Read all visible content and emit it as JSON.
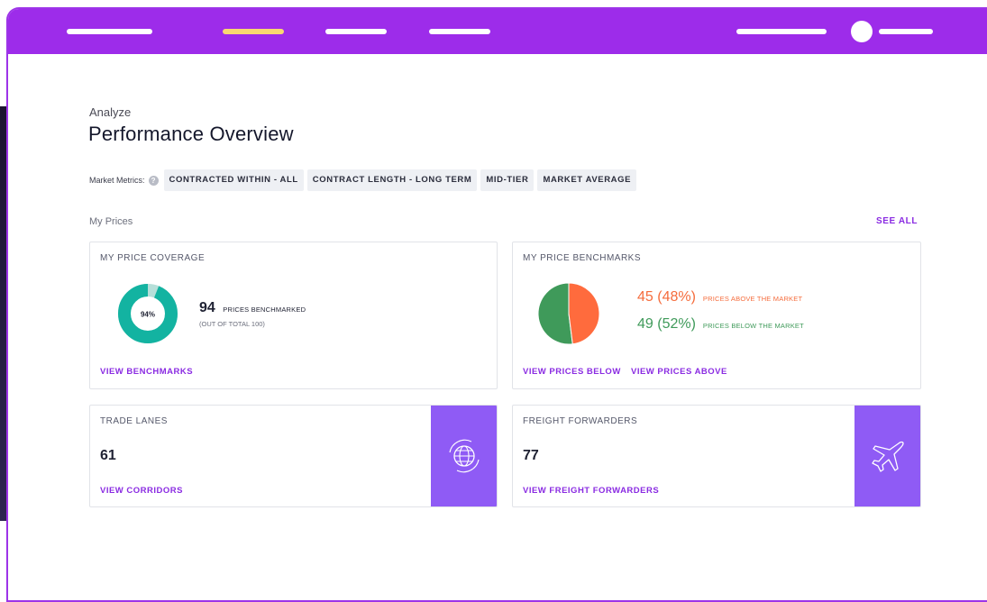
{
  "page": {
    "eyebrow": "Analyze",
    "title": "Performance Overview"
  },
  "metrics": {
    "label": "Market Metrics:",
    "help_icon": "help-circle-icon",
    "chips": [
      "CONTRACTED WITHIN - ALL",
      "CONTRACT LENGTH - LONG TERM",
      "MID-TIER",
      "MARKET AVERAGE"
    ]
  },
  "section": {
    "label": "My Prices",
    "see_all": "SEE ALL"
  },
  "coverage": {
    "title": "MY PRICE COVERAGE",
    "donut_label": "94%",
    "donut_fraction": 0.94,
    "count": "94",
    "count_label": "PRICES BENCHMARKED",
    "note": "(OUT OF TOTAL 100)",
    "link": "VIEW BENCHMARKS",
    "colors": {
      "fill": "#13b3a1",
      "rest": "#b6dfd9"
    }
  },
  "benchmarks": {
    "title": "MY PRICE BENCHMARKS",
    "above_value": "45 (48%)",
    "above_label": "PRICES ABOVE THE MARKET",
    "below_value": "49 (52%)",
    "below_label": "PRICES BELOW THE MARKET",
    "above_fraction": 0.48,
    "link_below": "VIEW PRICES BELOW",
    "link_above": "VIEW PRICES ABOVE",
    "colors": {
      "above": "#ff6b3d",
      "below": "#3f9a5a"
    }
  },
  "trade_lanes": {
    "title": "TRADE LANES",
    "count": "61",
    "link": "VIEW CORRIDORS",
    "icon": "globe-icon"
  },
  "forwarders": {
    "title": "FREIGHT FORWARDERS",
    "count": "77",
    "link": "VIEW FREIGHT FORWARDERS",
    "icon": "airplane-icon"
  },
  "theme": {
    "brand": "#9d2cea",
    "accent": "#8a2be2",
    "tab_active": "#f9d872"
  }
}
